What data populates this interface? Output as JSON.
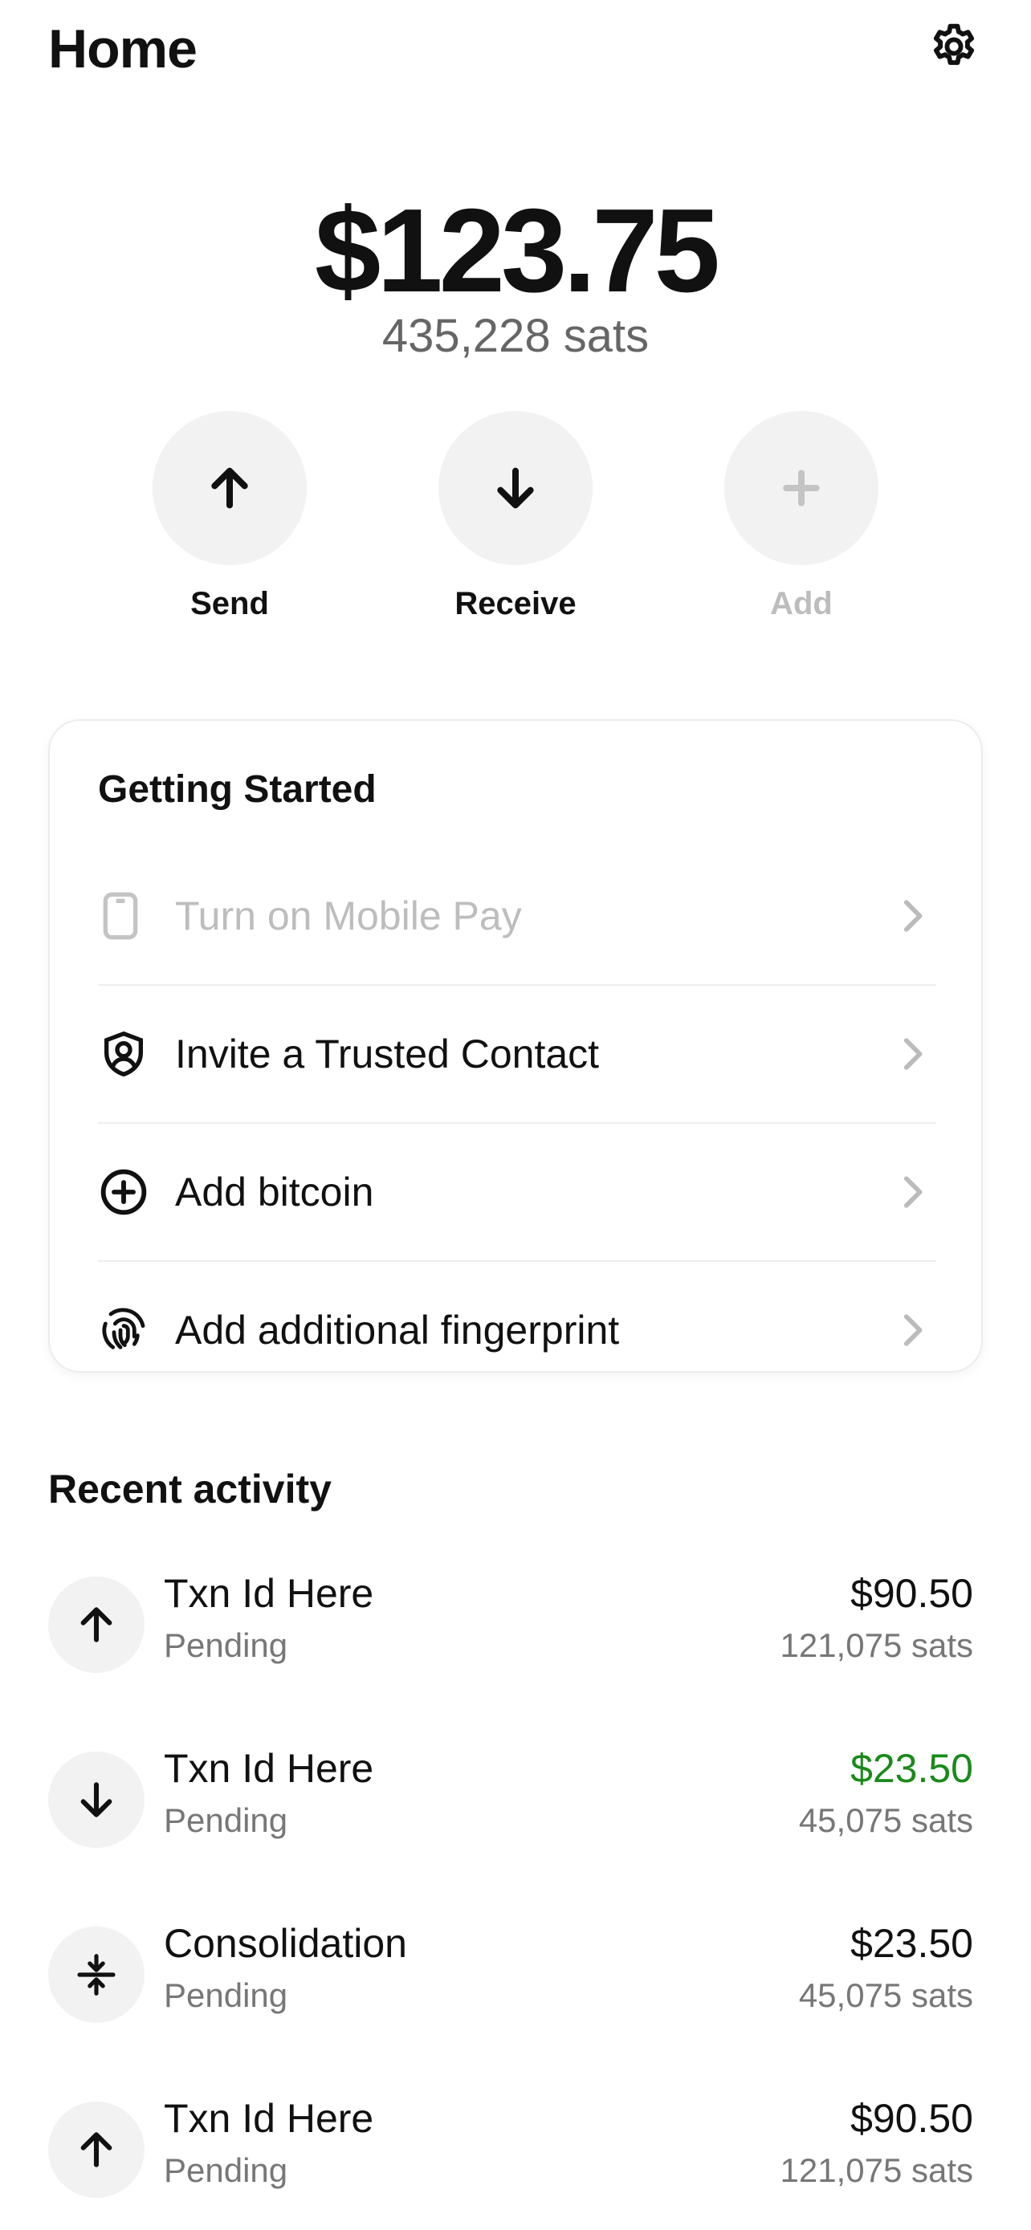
{
  "header": {
    "title": "Home",
    "settings_icon": "gear-icon"
  },
  "balance": {
    "fiat": "$123.75",
    "sats": "435,228 sats"
  },
  "actions": [
    {
      "label": "Send",
      "icon": "arrow-up-icon",
      "enabled": true
    },
    {
      "label": "Receive",
      "icon": "arrow-down-icon",
      "enabled": true
    },
    {
      "label": "Add",
      "icon": "plus-icon",
      "enabled": false
    }
  ],
  "getting_started": {
    "title": "Getting Started",
    "items": [
      {
        "label": "Turn on Mobile Pay",
        "icon": "phone-icon",
        "enabled": false
      },
      {
        "label": "Invite a Trusted Contact",
        "icon": "shield-person-icon",
        "enabled": true
      },
      {
        "label": "Add bitcoin",
        "icon": "plus-circle-icon",
        "enabled": true
      },
      {
        "label": "Add additional fingerprint",
        "icon": "fingerprint-icon",
        "enabled": true
      }
    ]
  },
  "recent_activity": {
    "title": "Recent activity",
    "transactions": [
      {
        "name": "Txn Id Here",
        "status": "Pending",
        "amount": "$90.50",
        "sats": "121,075 sats",
        "direction": "send",
        "icon": "arrow-up-icon"
      },
      {
        "name": "Txn Id Here",
        "status": "Pending",
        "amount": "$23.50",
        "sats": "45,075 sats",
        "direction": "receive",
        "icon": "arrow-down-icon"
      },
      {
        "name": "Consolidation",
        "status": "Pending",
        "amount": "$23.50",
        "sats": "45,075 sats",
        "direction": "consolidate",
        "icon": "consolidate-icon"
      },
      {
        "name": "Txn Id Here",
        "status": "Pending",
        "amount": "$90.50",
        "sats": "121,075 sats",
        "direction": "send",
        "icon": "arrow-up-icon"
      }
    ]
  },
  "colors": {
    "positive": "#1a8a1a",
    "muted": "#777777",
    "disabled": "#bdbdbd",
    "circle_bg": "#f2f2f2"
  }
}
